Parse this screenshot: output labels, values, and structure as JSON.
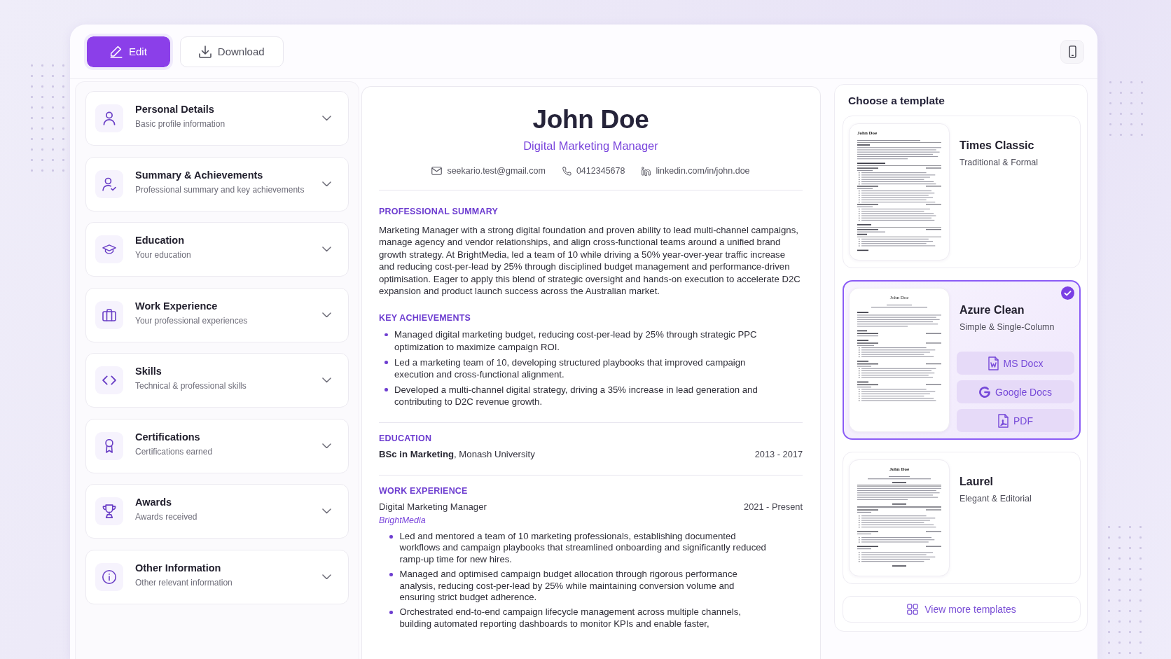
{
  "toolbar": {
    "modes": [
      {
        "label": "Edit",
        "selected": true
      },
      {
        "label": "Download",
        "selected": false
      }
    ]
  },
  "sidebar": {
    "sections": [
      {
        "title": "Personal Details",
        "subtitle": "Basic profile information",
        "expanded": false
      },
      {
        "title": "Summary & Achievements",
        "subtitle": "Professional summary and key achievements",
        "expanded": false
      },
      {
        "title": "Education",
        "subtitle": "Your education",
        "expanded": false
      },
      {
        "title": "Work Experience",
        "subtitle": "Your professional experiences",
        "expanded": false
      },
      {
        "title": "Skills",
        "subtitle": "Technical & professional skills",
        "expanded": false
      },
      {
        "title": "Certifications",
        "subtitle": "Certifications earned",
        "expanded": false
      },
      {
        "title": "Awards",
        "subtitle": "Awards received",
        "expanded": false
      },
      {
        "title": "Other Information",
        "subtitle": "Other relevant information",
        "expanded": false
      }
    ]
  },
  "resume": {
    "name": "John Doe",
    "headline": "Digital Marketing Manager",
    "contacts": [
      "seekario.test@gmail.com",
      "0412345678",
      "linkedin.com/in/john.doe"
    ],
    "sections": [
      {
        "kind": "paragraph",
        "heading": "PROFESSIONAL SUMMARY",
        "rule_above": false,
        "text": "Marketing Manager with a strong digital foundation and proven ability to lead multi-channel campaigns, manage agency and vendor relationships, and align cross-functional teams around a unified brand growth strategy. At BrightMedia, led a team of 10 while driving a 50% year-over-year traffic increase and reducing cost-per-lead by 25% through disciplined budget management and performance-driven optimisation. Eager to apply this blend of strategic oversight and hands-on execution to accelerate D2C expansion and product launch success across the Australian market."
      },
      {
        "kind": "bullets",
        "heading": "KEY ACHIEVEMENTS",
        "rule_above": false,
        "items": [
          "Managed digital marketing budget, reducing cost-per-lead by 25% through strategic PPC optimization to maximize campaign ROI.",
          "Led a marketing team of 10, developing structured playbooks that improved campaign execution and cross-functional alignment.",
          "Developed a multi-channel digital strategy, driving a 35% increase in lead generation and contributing to D2C revenue growth."
        ]
      },
      {
        "kind": "entries",
        "heading": "EDUCATION",
        "rule_above": true,
        "entries": [
          {
            "title": "**BSc in Marketing**, Monash University",
            "dates": "2013 - 2017"
          }
        ]
      },
      {
        "kind": "entries",
        "heading": "WORK EXPERIENCE",
        "rule_above": true,
        "entries": [
          {
            "title": "Digital Marketing Manager",
            "dates": "2021 - Present",
            "company": "BrightMedia",
            "bullets": [
              "Led and mentored a team of 10 marketing professionals, establishing documented workflows and campaign playbooks that streamlined onboarding and significantly reduced ramp-up time for new hires.",
              "Managed and optimised campaign budget allocation through rigorous performance analysis, reducing cost-per-lead by 25% while maintaining conversion volume and ensuring strict budget adherence.",
              "Orchestrated end-to-end campaign lifecycle management across multiple channels, building automated reporting dashboards to monitor KPIs and enable faster,"
            ]
          }
        ]
      }
    ]
  },
  "templates_panel": {
    "title": "Choose a template",
    "templates": [
      {
        "name": "Times Classic",
        "description": "Traditional & Formal",
        "selected": false,
        "thumbnail_title": "John Doe"
      },
      {
        "name": "Azure Clean",
        "description": "Simple & Single-Column",
        "selected": true,
        "thumbnail_title": "John Doe",
        "formats": [
          "MS Docx",
          "Google Docs",
          "PDF"
        ]
      },
      {
        "name": "Laurel",
        "description": "Elegant & Editorial",
        "selected": false,
        "thumbnail_title": "John Doe"
      }
    ],
    "view_more": "View more templates"
  }
}
